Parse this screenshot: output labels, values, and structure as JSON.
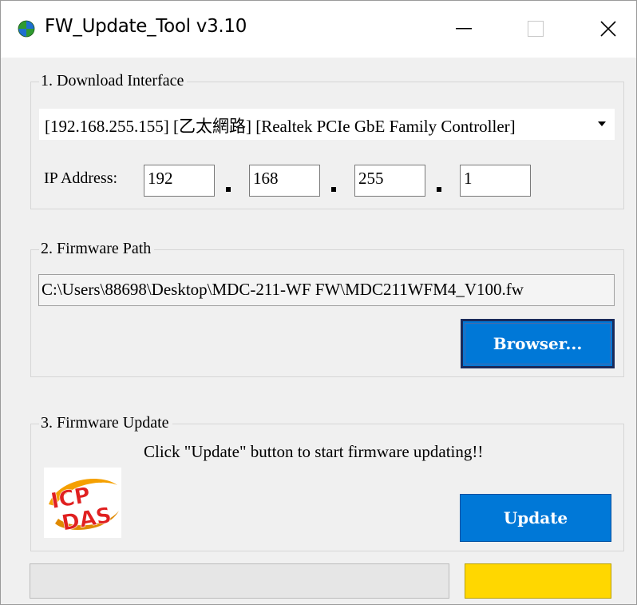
{
  "window": {
    "title": "FW_Update_Tool v3.10",
    "icon": "green-globe-icon"
  },
  "download_interface": {
    "legend": "1. Download Interface",
    "interface_selected": "[192.168.255.155] [乙太網路] [Realtek PCIe GbE Family Controller]",
    "ip_label": "IP Address:",
    "ip_octets": [
      "192",
      "168",
      "255",
      "1"
    ]
  },
  "firmware_path": {
    "legend": "2. Firmware Path",
    "path_value": "C:\\Users\\88698\\Desktop\\MDC-211-WF FW\\MDC211WFM4_V100.fw",
    "browse_label": "Browser..."
  },
  "firmware_update": {
    "legend": "3. Firmware Update",
    "hint": "Click \"Update\" button to start firmware updating!!",
    "update_label": "Update",
    "logo_text": "ICP DAS"
  },
  "status": {
    "progress_fraction": 0,
    "indicator_color": "#ffd700"
  },
  "colors": {
    "accent": "#0078d7",
    "indicator": "#ffd700"
  }
}
